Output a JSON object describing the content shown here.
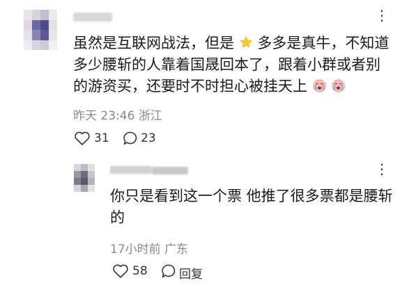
{
  "comment": {
    "text_part1": "虽然是互联网战法，但是",
    "text_part2": "多多是真牛，不知道",
    "line2": "多少腰斩的人靠着国晟回本了，跟着小群或者别",
    "line3": "的游资买，还要时不时担心被挂天上",
    "emoji_star_name": "star-emoji",
    "emoji_cry_name": "crying-face-emoji",
    "time": "昨天 23:46 浙江",
    "likes": "31",
    "replies": "23"
  },
  "reply": {
    "line1": "你只是看到这一个票 他推了很多票都是腰斩",
    "line2": "的",
    "time": "17小时前 广东",
    "likes": "58",
    "reply_label": "回复"
  },
  "more_label": "⋮",
  "colors": {
    "text": "#1a1a1a",
    "meta": "#8a8a8a",
    "icon": "#333333"
  },
  "avatar_main_cells": [
    "#e8e6ea",
    "#d7d3dc",
    "#c4bcd0",
    "#ebe9ee",
    "#dcd7e2",
    "#6f68a0",
    "#4f4a8a",
    "#e2dfe6",
    "#e4e1e8",
    "#8a83b2",
    "#5d5896",
    "#e9e7ec",
    "#eeedf0",
    "#d9d5df",
    "#cfcad8",
    "#f0eff2"
  ],
  "avatar_reply_cells": [
    "#d9d7db",
    "#bfbcc4",
    "#e0dfe2",
    "#9b98a3",
    "#6e6b7a",
    "#c7c6cc",
    "#7f7c8d",
    "#5c5970",
    "#b5b3ba",
    "#d6d5d9",
    "#a9a7b0",
    "#e3e2e5"
  ]
}
